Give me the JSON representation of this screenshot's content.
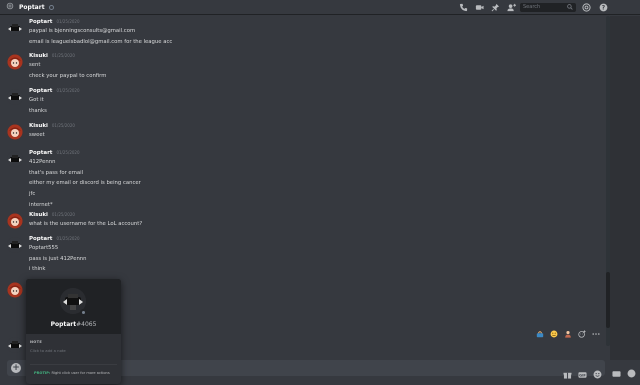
{
  "topbar": {
    "channel_name": "Poptart",
    "search_placeholder": "Search"
  },
  "messages": [
    {
      "author": "Poptart",
      "timestamp": "01/25/2020",
      "avatar": "poptart",
      "lines": [
        "paypal is bjenningsconsults@gmail.com",
        "email is leagueisbadlol@gmail.com for the league acc"
      ]
    },
    {
      "author": "Kisuki",
      "timestamp": "01/25/2020",
      "avatar": "kisuki",
      "lines": [
        "sent",
        "check your paypal to confirm"
      ]
    },
    {
      "author": "Poptart",
      "timestamp": "01/25/2020",
      "avatar": "poptart",
      "lines": [
        "Got it",
        "thanks"
      ]
    },
    {
      "author": "Kisuki",
      "timestamp": "01/25/2020",
      "avatar": "kisuki",
      "lines": [
        "sweet"
      ]
    },
    {
      "author": "Poptart",
      "timestamp": "01/25/2020",
      "avatar": "poptart",
      "lines": [
        "412Pennn",
        "that's pass for email",
        "either my email or discord is being cancer",
        "jfc",
        "internet*"
      ]
    },
    {
      "author": "Kisuki",
      "timestamp": "01/25/2020",
      "avatar": "kisuki",
      "lines": [
        "what is the username for the LoL account?"
      ]
    },
    {
      "author": "Poptart",
      "timestamp": "01/25/2020",
      "avatar": "poptart",
      "lines": [
        "Poptart555",
        "pass is just 412Pennn",
        "i think"
      ]
    }
  ],
  "popout": {
    "username": "Poptart",
    "discriminator": "#4065",
    "note_label": "NOTE",
    "note_placeholder": "Click to add a note",
    "protip_label": "PROTIP:",
    "protip_text": "Right click user for more actions"
  },
  "icons": {
    "top": [
      "call-icon",
      "video-icon",
      "pin-icon",
      "add-friend-icon"
    ],
    "top_right": [
      "mention-icon",
      "help-icon"
    ],
    "hover": [
      "reaction-1-icon",
      "reaction-2-icon",
      "reaction-3-icon",
      "add-reaction-icon",
      "more-icon"
    ],
    "composer": [
      "gift-icon",
      "gif-icon",
      "emoji-icon"
    ]
  },
  "colors": {
    "background": "#36393f",
    "popout": "#18191c",
    "protip": "#43b581"
  }
}
